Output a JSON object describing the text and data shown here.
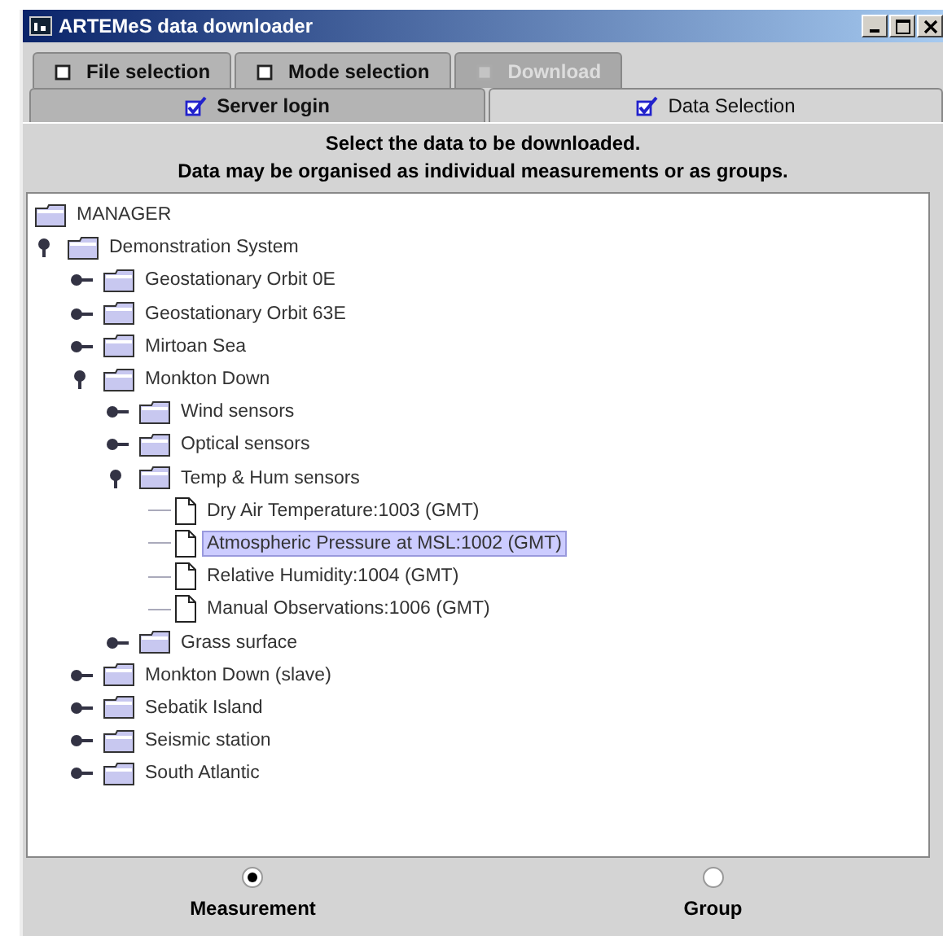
{
  "window": {
    "title": "ARTEMeS data downloader"
  },
  "tab_rows": [
    [
      {
        "label": "File selection",
        "checked": false,
        "selected": false,
        "disabled": false
      },
      {
        "label": "Mode selection",
        "checked": false,
        "selected": false,
        "disabled": false
      },
      {
        "label": "Download",
        "checked": false,
        "selected": false,
        "disabled": true
      }
    ],
    [
      {
        "label": "Server login",
        "checked": true,
        "selected": false,
        "disabled": false
      },
      {
        "label": "Data Selection",
        "checked": true,
        "selected": true,
        "disabled": false
      }
    ]
  ],
  "instructions": [
    "Select the data to be downloaded.",
    "Data may be organised as individual measurements or as groups."
  ],
  "tree": {
    "label": "MANAGER",
    "kind": "folder",
    "selected": false,
    "children": [
      {
        "label": "Demonstration System",
        "kind": "folder",
        "expanded": true,
        "selected": false,
        "children": [
          {
            "label": "Geostationary Orbit 0E",
            "kind": "folder",
            "expanded": false,
            "selected": false
          },
          {
            "label": "Geostationary Orbit 63E",
            "kind": "folder",
            "expanded": false,
            "selected": false
          },
          {
            "label": "Mirtoan Sea",
            "kind": "folder",
            "expanded": false,
            "selected": false
          },
          {
            "label": "Monkton Down",
            "kind": "folder",
            "expanded": true,
            "selected": false,
            "children": [
              {
                "label": "Wind sensors",
                "kind": "folder",
                "expanded": false,
                "selected": false
              },
              {
                "label": "Optical sensors",
                "kind": "folder",
                "expanded": false,
                "selected": false
              },
              {
                "label": "Temp & Hum sensors",
                "kind": "folder",
                "expanded": true,
                "selected": false,
                "children": [
                  {
                    "label": "Dry Air Temperature:1003 (GMT)",
                    "kind": "leaf",
                    "selected": false
                  },
                  {
                    "label": "Atmospheric Pressure at MSL:1002 (GMT)",
                    "kind": "leaf",
                    "selected": true
                  },
                  {
                    "label": "Relative Humidity:1004 (GMT)",
                    "kind": "leaf",
                    "selected": false
                  },
                  {
                    "label": "Manual Observations:1006 (GMT)",
                    "kind": "leaf",
                    "selected": false
                  }
                ]
              },
              {
                "label": "Grass surface",
                "kind": "folder",
                "expanded": false,
                "selected": false
              }
            ]
          },
          {
            "label": "Monkton Down (slave)",
            "kind": "folder",
            "expanded": false,
            "selected": false
          },
          {
            "label": "Sebatik Island",
            "kind": "folder",
            "expanded": false,
            "selected": false
          },
          {
            "label": "Seismic station",
            "kind": "folder",
            "expanded": false,
            "selected": false
          },
          {
            "label": "South Atlantic",
            "kind": "folder",
            "expanded": false,
            "selected": false
          }
        ]
      }
    ]
  },
  "grouping": [
    {
      "label": "Measurement",
      "selected": true
    },
    {
      "label": "Group",
      "selected": false
    }
  ]
}
